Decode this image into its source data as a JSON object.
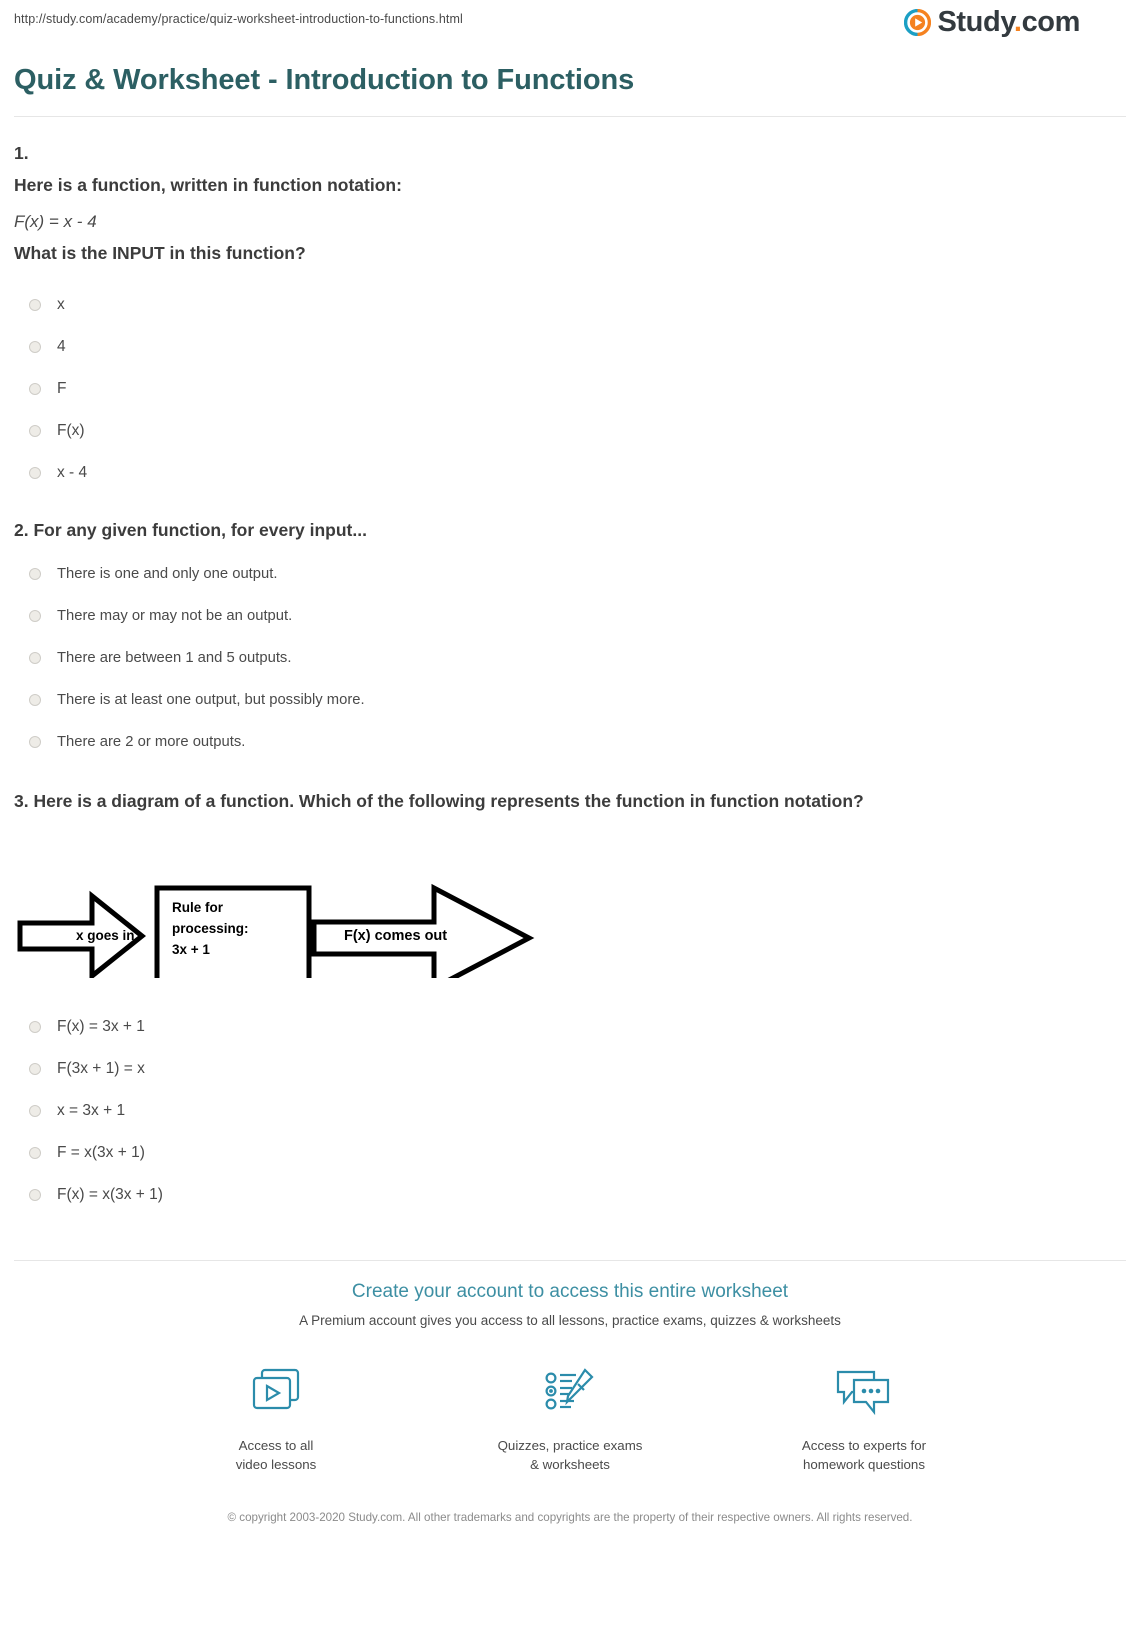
{
  "browser": {
    "url": "http://study.com/academy/practice/quiz-worksheet-introduction-to-functions.html"
  },
  "brand": {
    "name_main": "Study",
    "name_dot": ".",
    "name_tld": "com",
    "logo_icon": "play-circle-icon",
    "teal": "#2c5f63",
    "orange": "#f58220",
    "link_blue": "#3d8fa3"
  },
  "header": {
    "title": "Quiz & Worksheet - Introduction to Functions"
  },
  "questions": [
    {
      "number": "1.",
      "prompt": "Here is a function, written in function notation:",
      "formula": "F(x) = x - 4",
      "sub_prompt": "What is the INPUT in this function?",
      "options": [
        "x",
        "4",
        "F",
        "F(x)",
        "x - 4"
      ]
    },
    {
      "heading": "2. For any given function, for every input...",
      "options": [
        "There is one and only one output.",
        "There may or may not be an output.",
        "There are between 1 and 5 outputs.",
        "There is at least one output, but possibly more.",
        "There are 2 or more outputs."
      ]
    },
    {
      "heading": "3. Here is a diagram of a function. Which of the following represents the function in function notation?",
      "diagram": {
        "input_label": "x goes in",
        "box_line1": "Rule for",
        "box_line2": "processing:",
        "box_line3": "3x + 1",
        "output_label": "F(x) comes out"
      },
      "options": [
        "F(x) = 3x + 1",
        "F(3x + 1) = x",
        "x = 3x + 1",
        "F = x(3x + 1)",
        "F(x) = x(3x + 1)"
      ]
    }
  ],
  "promo": {
    "headline": "Create your account to access this entire worksheet",
    "subline": "A Premium account gives you access to all lessons, practice exams, quizzes & worksheets",
    "perks": [
      {
        "icon": "video-lessons-icon",
        "line1": "Access to all",
        "line2": "video lessons"
      },
      {
        "icon": "quiz-pencil-icon",
        "line1": "Quizzes, practice exams",
        "line2": "& worksheets"
      },
      {
        "icon": "chat-bubbles-icon",
        "line1": "Access to experts for",
        "line2": "homework questions"
      }
    ]
  },
  "footer": {
    "copyright": "© copyright 2003-2020 Study.com. All other trademarks and copyrights are the property of their respective owners. All rights reserved."
  }
}
